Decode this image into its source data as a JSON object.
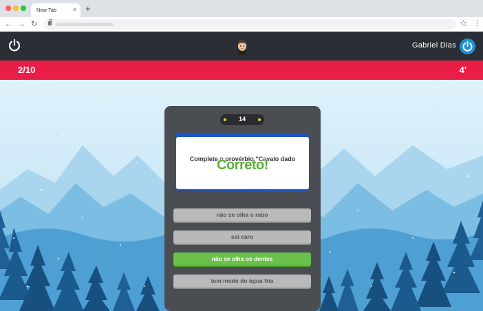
{
  "browser": {
    "tab_title": "New Tab",
    "tab_close": "×",
    "new_tab": "+",
    "back": "←",
    "forward": "→",
    "reload": "↻",
    "star": "☆",
    "menu": "⋮"
  },
  "header": {
    "user_name": "Gabriel Dias",
    "icons": [
      "power-icon",
      "avatar",
      "power-icon"
    ],
    "accent_color": "#1e90d6"
  },
  "progress": {
    "question_counter": "2/10",
    "time_left": "4'",
    "bar_color": "#e91e46"
  },
  "quiz": {
    "score": "14",
    "question": "Complete o provérbio “Cavalo dado",
    "feedback": "Correto!",
    "answers": [
      {
        "label": "não se olha o rabo",
        "state": "neutral"
      },
      {
        "label": "sai caro",
        "state": "neutral"
      },
      {
        "label": "não se olha os dentes",
        "state": "correct"
      },
      {
        "label": "tem medo do água fria",
        "state": "neutral"
      }
    ],
    "correct_color": "#6ac04a"
  }
}
